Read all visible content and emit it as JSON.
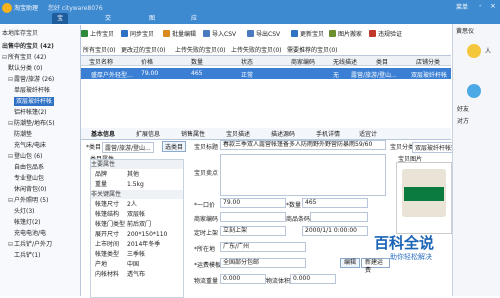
{
  "titlebar": {
    "app": "淘宝助理",
    "user": "您好 cityware8076",
    "tabs": [
      "宝贝管理",
      "交易管理",
      "图片空间",
      "应用中心"
    ],
    "active_tab": "宝贝管理",
    "menu": "菜单",
    "win_min": "-",
    "win_close": "×"
  },
  "left": {
    "header": "本地库存宝贝",
    "section": "出售中的宝贝 (42)",
    "tree": [
      {
        "label": "所有宝贝 (42)",
        "indent": 0,
        "exp": "⊟"
      },
      {
        "label": "默认分类 (0)",
        "indent": 1
      },
      {
        "label": "露营/旅游 (26)",
        "indent": 1,
        "exp": "⊟"
      },
      {
        "label": "单层玻纤杆帐",
        "indent": 2
      },
      {
        "label": "双层玻纤杆帐",
        "indent": 2,
        "selected": true
      },
      {
        "label": "铝杆帐篷(2)",
        "indent": 2
      },
      {
        "label": "防潮垫/地布(5)",
        "indent": 1,
        "exp": "⊟"
      },
      {
        "label": "防潮垫",
        "indent": 2
      },
      {
        "label": "充气床/电床",
        "indent": 2
      },
      {
        "label": "登山包 (6)",
        "indent": 1,
        "exp": "⊟"
      },
      {
        "label": "自由包品系",
        "indent": 2
      },
      {
        "label": "专业登山包",
        "indent": 2
      },
      {
        "label": "休闲背包(0)",
        "indent": 2
      },
      {
        "label": "户外照明 (5)",
        "indent": 1,
        "exp": "⊟"
      },
      {
        "label": "头灯(3)",
        "indent": 2
      },
      {
        "label": "帐篷灯(2)",
        "indent": 2
      },
      {
        "label": "充电电池/电",
        "indent": 2
      },
      {
        "label": "工兵铲/户外刀",
        "indent": 1,
        "exp": "⊟"
      },
      {
        "label": "工兵铲(1)",
        "indent": 2
      }
    ]
  },
  "toolbar": [
    {
      "label": "上传宝贝",
      "color": "#2f8a3c"
    },
    {
      "label": "同步宝贝",
      "color": "#2f71c4"
    },
    {
      "label": "批量编辑",
      "color": "#d9891c"
    },
    {
      "label": "导入CSV",
      "color": "#4a7bc1"
    },
    {
      "label": "导出CSV",
      "color": "#4a7bc1"
    },
    {
      "label": "更新宝贝",
      "color": "#2f71c4"
    },
    {
      "label": "图片搬家",
      "color": "#6b8e2f"
    },
    {
      "label": "违规验证",
      "color": "#c0392b"
    }
  ],
  "subtabs": [
    "所有宝贝(0)",
    "更改过的宝贝(0)",
    "上传失败的宝贝(0)",
    "上传失败的宝贝(0)",
    "需要推荐的宝贝(0)"
  ],
  "grid": {
    "headers": [
      "宝贝名称",
      "价格",
      "数量",
      "状态",
      "商家编码",
      "无线描述",
      "类目",
      "店铺分类",
      "宝贝"
    ],
    "row": [
      "盛厚户外轻型...",
      "79.00",
      "465",
      "正常",
      "",
      "无",
      "露营/旅游/登山...",
      "双层玻纤杆帐",
      ""
    ]
  },
  "detail_tabs": [
    "基本信息",
    "扩展信息",
    "销售属性",
    "宝贝描述",
    "描述源码",
    "手机详情",
    "适宜计"
  ],
  "category": {
    "label": "*类目",
    "value": "露营/旅游/登山...",
    "select_btn": "选类目",
    "props_title": "类目属性",
    "groups": [
      "主要属性",
      "非关键属性"
    ],
    "props": [
      {
        "k": "品牌",
        "v": "其他"
      },
      {
        "k": "重量",
        "v": "1.5kg"
      },
      {
        "k": "帐篷尺寸",
        "v": "2人"
      },
      {
        "k": "帐篷结构",
        "v": "双层帐"
      },
      {
        "k": "帐篷门类型",
        "v": "前后双门"
      },
      {
        "k": "展开尺寸",
        "v": "200*150*110"
      },
      {
        "k": "上市时间",
        "v": "2014年冬季"
      },
      {
        "k": "帐篷类型",
        "v": "三季帐"
      },
      {
        "k": "产地",
        "v": "中国"
      },
      {
        "k": "内帐材料",
        "v": "透气布"
      }
    ]
  },
  "form": {
    "title_label": "宝贝标题",
    "title_value": "春款三季双人露营帐篷备多人防雨野外野营防暴雨59/60",
    "desc_label": "宝贝卖点",
    "price_label": "*一口价",
    "price_value": "79.00",
    "qty_label": "*数量",
    "qty_value": "465",
    "code_label": "商家编码",
    "barcode_label": "商品条码",
    "time_label": "定时上架",
    "time_value": "立刻上架",
    "time_date": "2000/1/1 0:00:00",
    "location_label": "*所在地",
    "location_value": "广东/广州",
    "freight_label": "*运费模板",
    "freight_value": "全国部分包邮",
    "edit_btn": "编辑",
    "new_btn": "新建运费",
    "weight_label": "物流重量",
    "weight_value": "0.000",
    "volume_label": "物流体积",
    "volume_value": "0.000",
    "shop_cat_label": "宝贝分类",
    "shop_cat_value": "双层玻纤杆帐篷"
  },
  "image_panel": {
    "title": "宝贝图片",
    "tab": "宝贝分类"
  },
  "right": {
    "chat_title": "黄思仪",
    "line1": "人",
    "line2": "好友",
    "line3": "对方"
  },
  "watermark": {
    "main": "百科全说",
    "sub": "助你轻松解决"
  }
}
